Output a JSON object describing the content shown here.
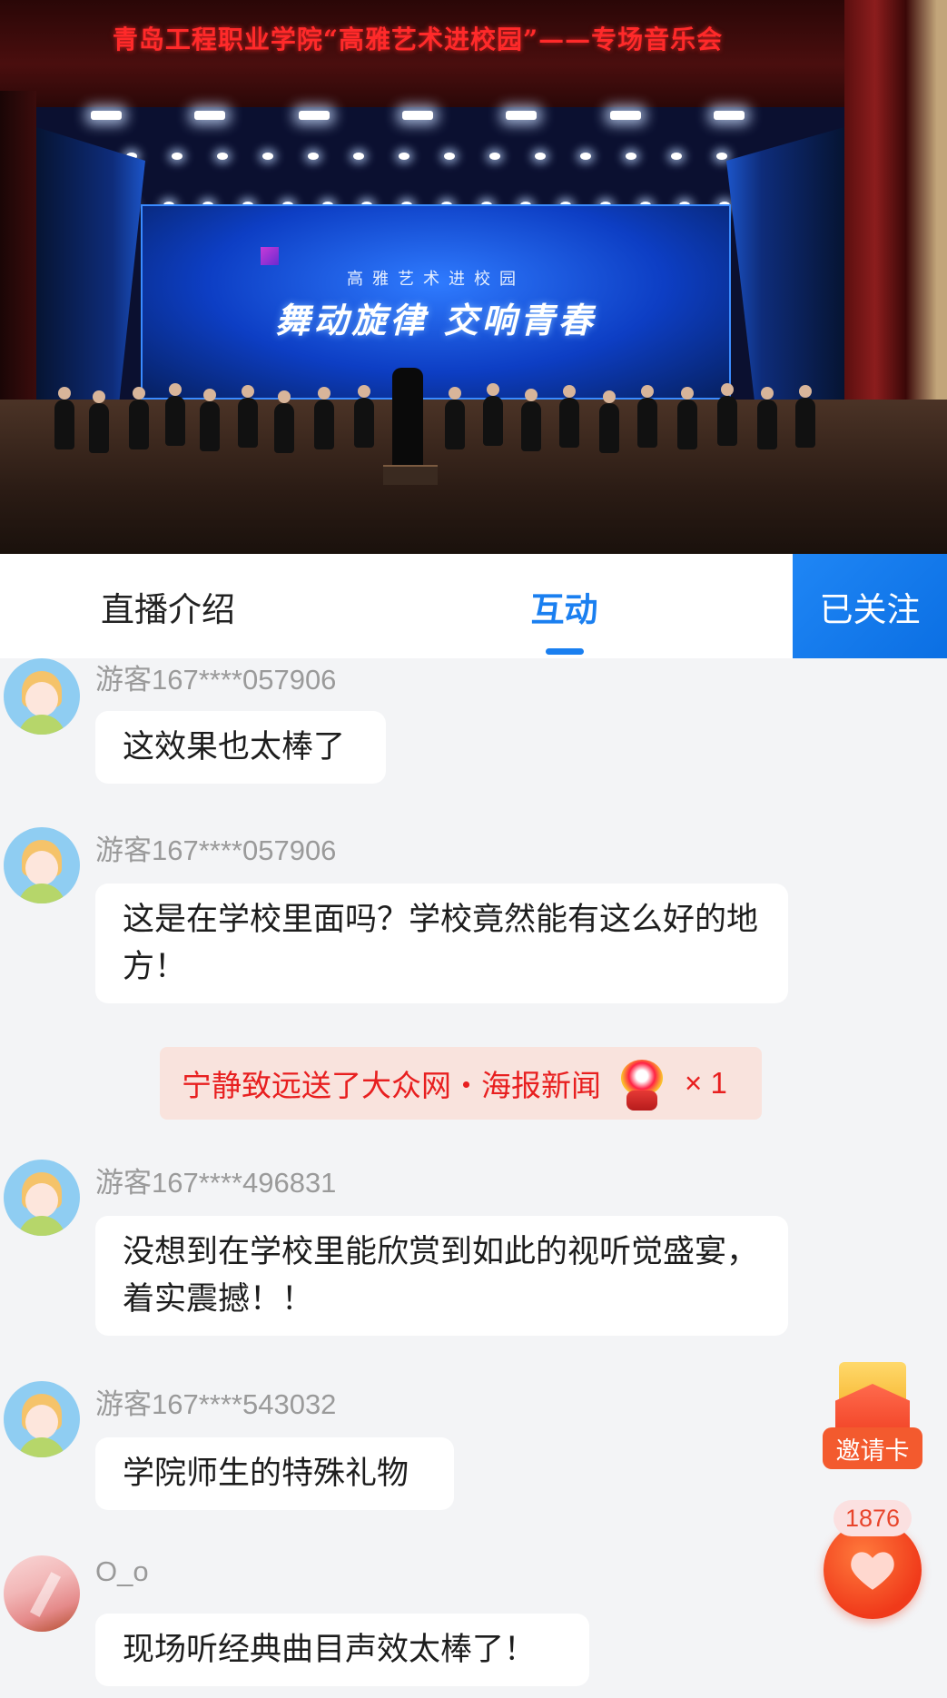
{
  "video": {
    "banner": "青岛工程职业学院“高雅艺术进校园”——专场音乐会",
    "screen_subtitle": "高雅艺术进校园",
    "screen_title": "舞动旋律 交响青春"
  },
  "tabs": {
    "intro": "直播介绍",
    "interact": "互动",
    "follow": "已关注"
  },
  "messages": [
    {
      "user": "游客167****057906",
      "text": "这效果也太棒了"
    },
    {
      "user": "游客167****057906",
      "text": "这是在学校里面吗？学校竟然能有这么好的地方！"
    },
    {
      "user": "游客167****496831",
      "text": "没想到在学校里能欣赏到如此的视听觉盛宴，着实震撼！！"
    },
    {
      "user": "游客167****543032",
      "text": "学院师生的特殊礼物"
    },
    {
      "user": "O_o",
      "text": "现场听经典曲目声效太棒了！"
    }
  ],
  "gift": {
    "text": "宁静致远送了大众网・海报新闻",
    "count": "× 1",
    "icon": "lion-dance-icon"
  },
  "floating": {
    "invite_label": "邀请卡",
    "like_count": "1876"
  },
  "colors": {
    "accent": "#1a7ff0",
    "gift_text": "#e81f1f",
    "like": "#f03a1a"
  }
}
